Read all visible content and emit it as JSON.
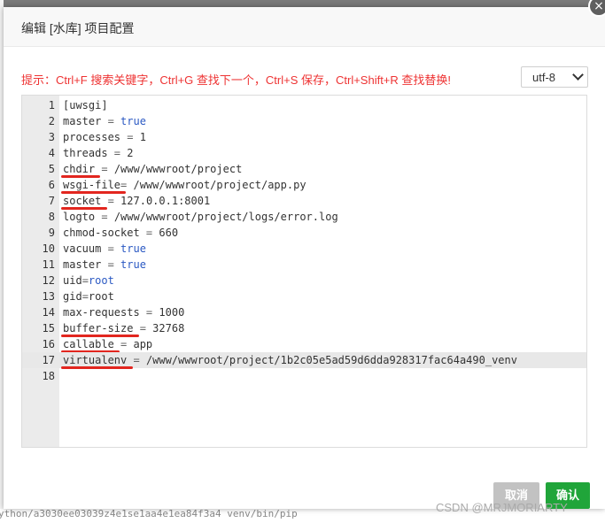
{
  "dialog": {
    "title": "编辑 [水库] 项目配置",
    "close_glyph": "×",
    "tip": "提示：Ctrl+F 搜索关键字，Ctrl+G 查找下一个，Ctrl+S 保存，Ctrl+Shift+R 查找替换!",
    "encoding": {
      "selected": "utf-8"
    },
    "buttons": {
      "cancel": "取消",
      "ok": "确认"
    }
  },
  "editor": {
    "active_line": 17,
    "lines": [
      {
        "n": "1",
        "key": "[uwsgi]",
        "op": "",
        "val": "",
        "val_kw": false
      },
      {
        "n": "2",
        "key": "master",
        "op": " = ",
        "val": "true",
        "val_kw": true
      },
      {
        "n": "3",
        "key": "processes",
        "op": " = ",
        "val": "1",
        "val_kw": false
      },
      {
        "n": "4",
        "key": "threads",
        "op": " = ",
        "val": "2",
        "val_kw": false
      },
      {
        "n": "5",
        "key": "chdir",
        "op": " = ",
        "val": "/www/wwwroot/project",
        "val_kw": false
      },
      {
        "n": "6",
        "key": "wsgi-file",
        "op": "= ",
        "val": "/www/wwwroot/project/app.py",
        "val_kw": false
      },
      {
        "n": "7",
        "key": "socket",
        "op": " = ",
        "val": "127.0.0.1:8001",
        "val_kw": false
      },
      {
        "n": "8",
        "key": "logto",
        "op": " = ",
        "val": "/www/wwwroot/project/logs/error.log",
        "val_kw": false
      },
      {
        "n": "9",
        "key": "chmod-socket",
        "op": " = ",
        "val": "660",
        "val_kw": false
      },
      {
        "n": "10",
        "key": "vacuum",
        "op": " = ",
        "val": "true",
        "val_kw": true
      },
      {
        "n": "11",
        "key": "master",
        "op": " = ",
        "val": "true",
        "val_kw": true
      },
      {
        "n": "12",
        "key": "uid",
        "op": "=",
        "val": "root",
        "val_kw": true
      },
      {
        "n": "13",
        "key": "gid",
        "op": "=",
        "val": "root",
        "val_kw": false
      },
      {
        "n": "14",
        "key": "max-requests",
        "op": " = ",
        "val": "1000",
        "val_kw": false
      },
      {
        "n": "15",
        "key": "buffer-size",
        "op": " = ",
        "val": "32768",
        "val_kw": false
      },
      {
        "n": "16",
        "key": "callable",
        "op": " = ",
        "val": "app",
        "val_kw": false
      },
      {
        "n": "17",
        "key": "virtualenv",
        "op": " = ",
        "val": "/www/wwwroot/project/1b2c05e5ad59d6dda928317fac64a490_venv",
        "val_kw": false
      },
      {
        "n": "18",
        "key": "",
        "op": "",
        "val": "",
        "val_kw": false
      }
    ]
  },
  "background": {
    "bottom_text": "ython/a3030ee03039z4e1se1aa4e1ea84f3a4 venv/bin/pip"
  },
  "watermark": "CSDN @MRJMORIARTY",
  "colors": {
    "tip": "#e33333",
    "keyword": "#2b59c3",
    "annotation": "#e2261f",
    "ok_button": "#20a53a",
    "cancel_button": "#c2c2c2"
  }
}
